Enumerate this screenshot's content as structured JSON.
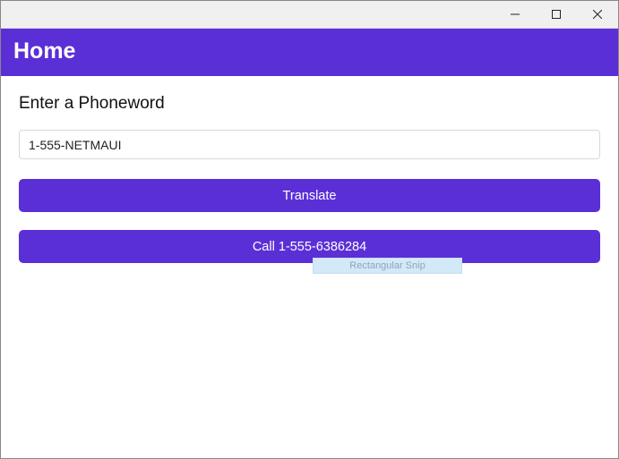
{
  "window": {
    "title": ""
  },
  "header": {
    "title": "Home"
  },
  "main": {
    "label": "Enter a Phoneword",
    "input_value": "1-555-NETMAUI",
    "translate_button": "Translate",
    "call_button": "Call 1-555-6386284"
  },
  "tooltip": {
    "text": "Rectangular Snip"
  },
  "colors": {
    "accent": "#5b2fd6"
  }
}
